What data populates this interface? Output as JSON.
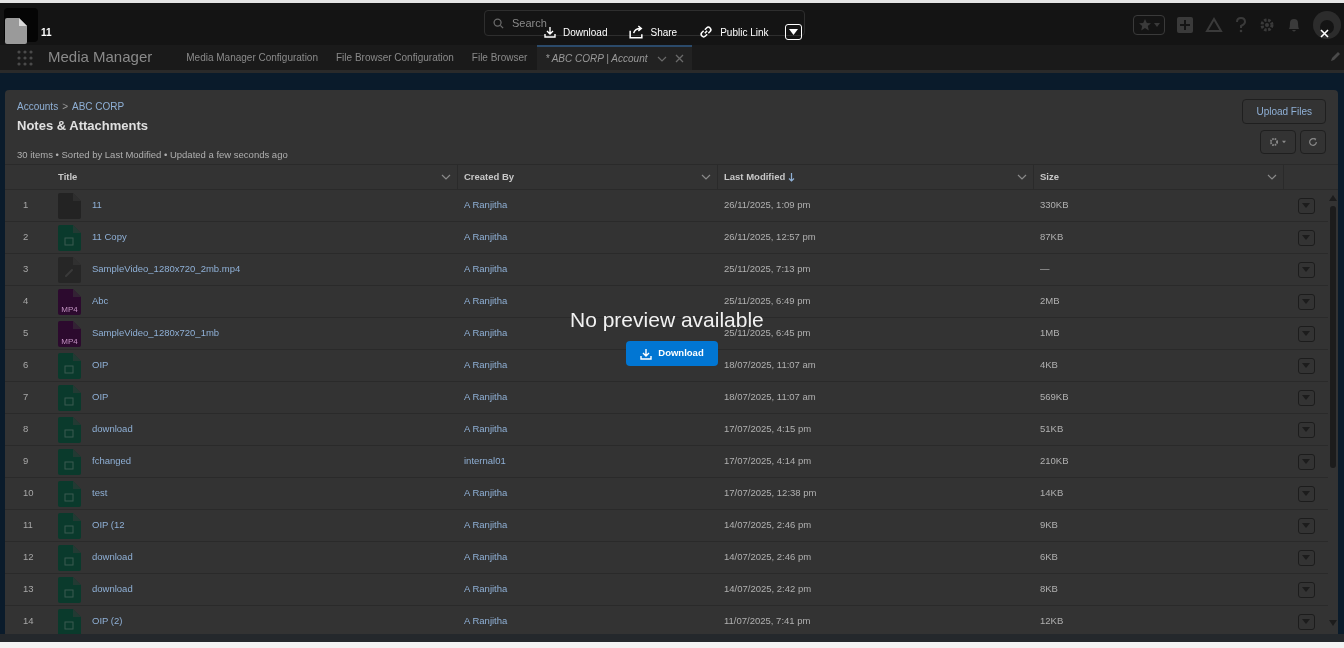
{
  "preview": {
    "title": "11",
    "actions": [
      {
        "kind": "download",
        "label": "Download"
      },
      {
        "kind": "share",
        "label": "Share"
      },
      {
        "kind": "link",
        "label": "Public Link"
      }
    ],
    "message": "No preview available",
    "download_button": "Download"
  },
  "app": {
    "search": {
      "placeholder": "Search"
    },
    "name": "Media Manager",
    "tabs": [
      {
        "label": "Media Manager Configuration",
        "selected": false
      },
      {
        "label": "File Browser Configuration",
        "selected": false
      },
      {
        "label": "File Browser",
        "selected": false
      },
      {
        "label": "* ABC CORP | Account",
        "selected": true
      }
    ]
  },
  "list": {
    "breadcrumb": [
      {
        "label": "Accounts"
      },
      {
        "label": "ABC CORP"
      }
    ],
    "separator": ">",
    "title": "Notes & Attachments",
    "meta": "30 items • Sorted by Last Modified • Updated a few seconds ago",
    "upload_button": "Upload Files",
    "columns": [
      {
        "label": "Title",
        "sorted": false
      },
      {
        "label": "Created By",
        "sorted": false
      },
      {
        "label": "Last Modified",
        "sorted": true
      },
      {
        "label": "Size",
        "sorted": false
      }
    ],
    "rows": [
      {
        "number": "1",
        "title": "11",
        "kind": "unknown",
        "created_by": "A Ranjitha",
        "last_modified": "26/11/2025, 1:09 pm",
        "size": "330KB"
      },
      {
        "number": "2",
        "title": "11 Copy",
        "kind": "image",
        "created_by": "A Ranjitha",
        "last_modified": "26/11/2025, 12:57 pm",
        "size": "87KB"
      },
      {
        "number": "3",
        "title": "SampleVideo_1280x720_2mb.mp4",
        "kind": "attachment",
        "created_by": "A Ranjitha",
        "last_modified": "25/11/2025, 7:13 pm",
        "size": "—"
      },
      {
        "number": "4",
        "title": "Abc",
        "kind": "video",
        "badge": "MP4",
        "created_by": "A Ranjitha",
        "last_modified": "25/11/2025, 6:49 pm",
        "size": "2MB"
      },
      {
        "number": "5",
        "title": "SampleVideo_1280x720_1mb",
        "kind": "video",
        "badge": "MP4",
        "created_by": "A Ranjitha",
        "last_modified": "25/11/2025, 6:45 pm",
        "size": "1MB"
      },
      {
        "number": "6",
        "title": "OIP",
        "kind": "image",
        "created_by": "A Ranjitha",
        "last_modified": "18/07/2025, 11:07 am",
        "size": "4KB"
      },
      {
        "number": "7",
        "title": "OIP",
        "kind": "image",
        "created_by": "A Ranjitha",
        "last_modified": "18/07/2025, 11:07 am",
        "size": "569KB"
      },
      {
        "number": "8",
        "title": "download",
        "kind": "image",
        "created_by": "A Ranjitha",
        "last_modified": "17/07/2025, 4:15 pm",
        "size": "51KB"
      },
      {
        "number": "9",
        "title": "fchanged",
        "kind": "image",
        "created_by": "internal01",
        "last_modified": "17/07/2025, 4:14 pm",
        "size": "210KB"
      },
      {
        "number": "10",
        "title": "test",
        "kind": "image",
        "created_by": "A Ranjitha",
        "last_modified": "17/07/2025, 12:38 pm",
        "size": "14KB"
      },
      {
        "number": "11",
        "title": "OIP (12",
        "kind": "image",
        "created_by": "A Ranjitha",
        "last_modified": "14/07/2025, 2:46 pm",
        "size": "9KB"
      },
      {
        "number": "12",
        "title": "download",
        "kind": "image",
        "created_by": "A Ranjitha",
        "last_modified": "14/07/2025, 2:46 pm",
        "size": "6KB"
      },
      {
        "number": "13",
        "title": "download",
        "kind": "image",
        "created_by": "A Ranjitha",
        "last_modified": "14/07/2025, 2:42 pm",
        "size": "8KB"
      },
      {
        "number": "14",
        "title": "OIP (2)",
        "kind": "image",
        "created_by": "A Ranjitha",
        "last_modified": "11/07/2025, 7:41 pm",
        "size": "12KB"
      }
    ]
  }
}
